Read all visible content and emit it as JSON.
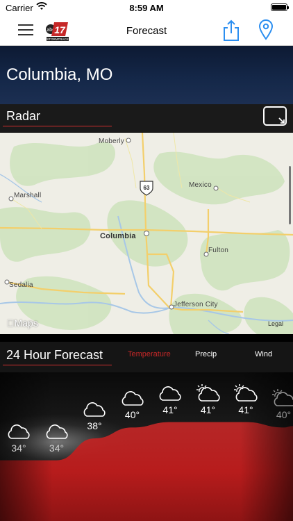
{
  "status": {
    "carrier": "Carrier",
    "time": "8:59 AM"
  },
  "nav": {
    "title": "Forecast",
    "logo_text": "17",
    "logo_sub": "STORMTRACK"
  },
  "location": {
    "city": "Columbia, MO"
  },
  "radar": {
    "title": "Radar",
    "map": {
      "places": [
        "Moberly",
        "Mexico",
        "Marshall",
        "Columbia",
        "Fulton",
        "Sedalia",
        "Jefferson City"
      ],
      "highway": "63",
      "attribution": "Maps",
      "legal": "Legal"
    }
  },
  "forecast": {
    "title": "24 Hour Forecast",
    "tabs": [
      "Temperature",
      "Precip",
      "Wind"
    ],
    "active_tab": "Temperature",
    "unit": "°F",
    "hours": [
      {
        "temp": "34°",
        "icon": "cloud-icon"
      },
      {
        "temp": "34°",
        "icon": "cloud-icon"
      },
      {
        "temp": "38°",
        "icon": "cloud-icon"
      },
      {
        "temp": "40°",
        "icon": "cloud-icon"
      },
      {
        "temp": "41°",
        "icon": "cloud-icon"
      },
      {
        "temp": "41°",
        "icon": "partly-sunny-icon"
      },
      {
        "temp": "41°",
        "icon": "partly-sunny-icon"
      },
      {
        "temp": "40°",
        "icon": "partly-sunny-icon"
      }
    ]
  },
  "colors": {
    "accent": "#d32f2f",
    "band": "#142748",
    "nav_icon": "#2b8ef0"
  }
}
